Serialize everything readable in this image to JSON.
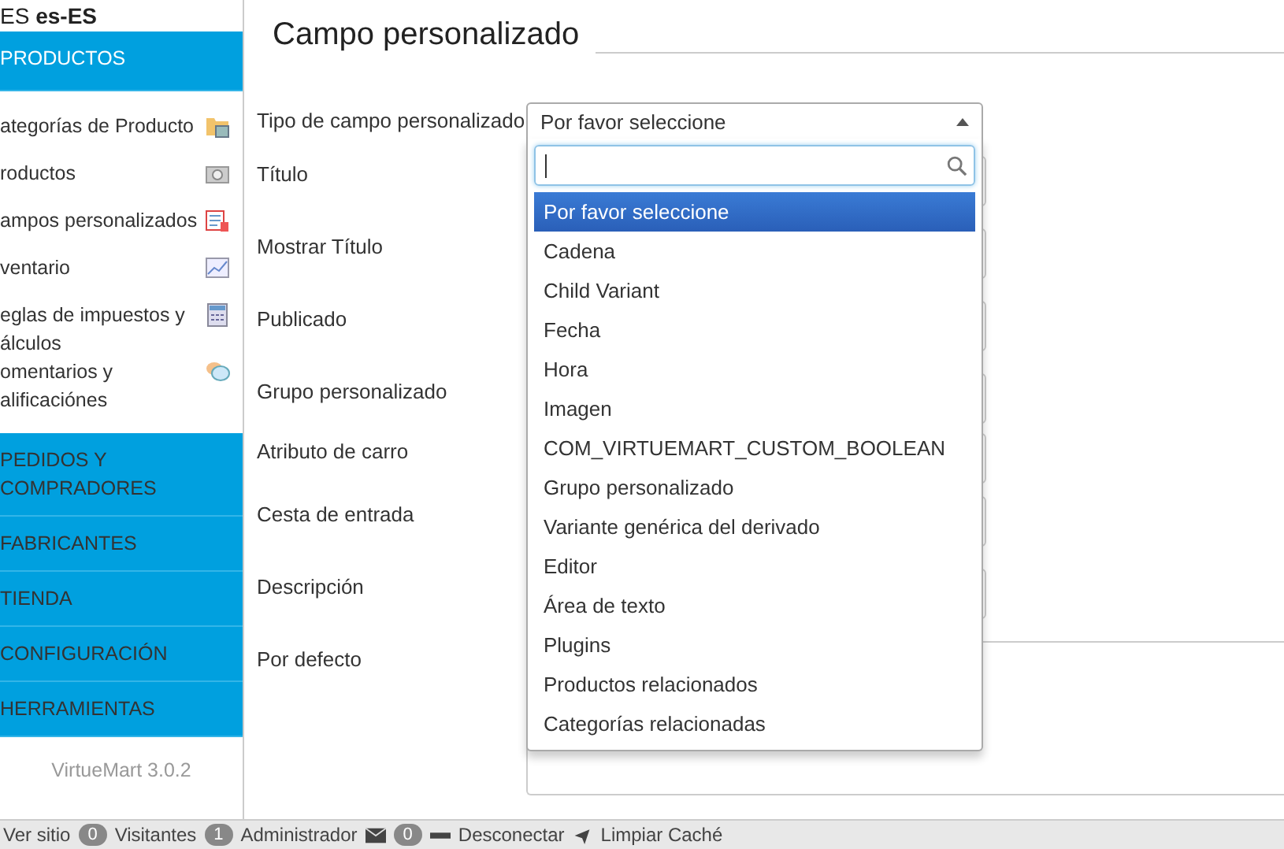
{
  "sidebar": {
    "language": "ES **es-ES**",
    "sections": [
      {
        "label": "PRODUCTOS",
        "expanded": true,
        "items": [
          {
            "lines": [
              "ategorías de Producto"
            ]
          },
          {
            "lines": [
              "roductos"
            ]
          },
          {
            "lines": [
              "ampos personalizados"
            ]
          },
          {
            "lines": [
              "ventario"
            ]
          },
          {
            "lines": [
              "eglas de impuestos y",
              "álculos"
            ]
          },
          {
            "lines": [
              "omentarios y",
              "alificaciónes"
            ]
          }
        ]
      },
      {
        "label": "PEDIDOS Y COMPRADORES",
        "expanded": false
      },
      {
        "label": "FABRICANTES",
        "expanded": false
      },
      {
        "label": "TIENDA",
        "expanded": false
      },
      {
        "label": "CONFIGURACIÓN",
        "expanded": false
      },
      {
        "label": "HERRAMIENTAS",
        "expanded": false
      }
    ],
    "footer": "VirtueMart 3.0.2"
  },
  "title": "Campo personalizado",
  "form": {
    "fields": [
      {
        "label": "Tipo de campo personalizado"
      },
      {
        "label": "Título"
      },
      {
        "label": "Mostrar Título"
      },
      {
        "label": "Publicado"
      },
      {
        "label": "Grupo personalizado"
      },
      {
        "label": "Atributo de carro"
      },
      {
        "label": "Cesta de entrada"
      },
      {
        "label": "Descripción"
      },
      {
        "label": "Por defecto"
      }
    ]
  },
  "dropdown": {
    "value": "Por favor seleccione",
    "expanded": true,
    "options": [
      {
        "label": "Por favor seleccione",
        "selected": true
      },
      {
        "label": "Cadena",
        "selected": false
      },
      {
        "label": "Child Variant",
        "selected": false
      },
      {
        "label": "Fecha",
        "selected": false
      },
      {
        "label": "Hora",
        "selected": false
      },
      {
        "label": "Imagen",
        "selected": false
      },
      {
        "label": "COM_VIRTUEMART_CUSTOM_BOOLEAN",
        "selected": false
      },
      {
        "label": "Grupo personalizado",
        "selected": false
      },
      {
        "label": "Variante genérica del derivado",
        "selected": false
      },
      {
        "label": "Editor",
        "selected": false
      },
      {
        "label": "Área de texto",
        "selected": false
      },
      {
        "label": "Plugins",
        "selected": false
      },
      {
        "label": "Productos relacionados",
        "selected": false
      },
      {
        "label": "Categorías relacionadas",
        "selected": false
      }
    ]
  },
  "status_bar": {
    "view_site": "Ver sitio",
    "visitors_count": "0",
    "visitors": "Visitantes",
    "admins_count": "1",
    "admins": "Administrador",
    "messages_count": "0",
    "logout": "Desconectar",
    "clear_cache": "Limpiar Caché"
  }
}
